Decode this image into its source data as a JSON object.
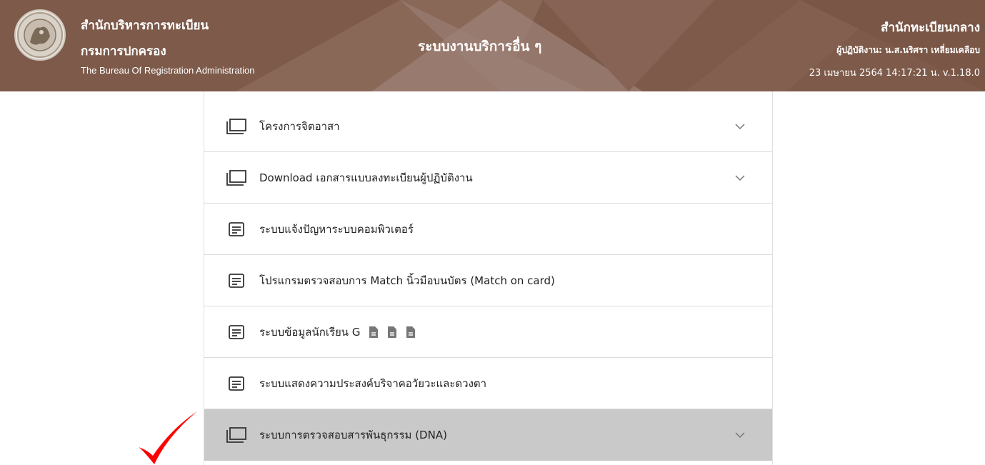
{
  "header": {
    "org_name_line1": "สำนักบริหารการทะเบียน",
    "org_name_line2": "กรมการปกครอง",
    "org_name_en": "The Bureau Of Registration Administration",
    "page_title": "ระบบงานบริการอื่น ๆ",
    "office_name": "สำนักทะเบียนกลาง",
    "operator": "ผู้ปฏิบัติงาน: น.ส.นริศรา เหลี่ยมเคลือบ",
    "datetime_version": "23 เมษายน 2564 14:17:21 น.  v.1.18.0",
    "colors": {
      "background": "#7d5a4a",
      "text": "#ffffff"
    }
  },
  "menu": {
    "items": [
      {
        "label": "โครงการจิตอาสา",
        "icon": "folder-icon",
        "expandable": true
      },
      {
        "label": "Download เอกสารแบบลงทะเบียนผู้ปฏิบัติงาน",
        "icon": "folder-icon",
        "expandable": true
      },
      {
        "label": "ระบบแจ้งปัญหาระบบคอมพิวเตอร์",
        "icon": "document-list-icon",
        "expandable": false
      },
      {
        "label": "โปรแกรมตรวจสอบการ Match นิ้วมือบนบัตร (Match on card)",
        "icon": "document-list-icon",
        "expandable": false
      },
      {
        "label": "ระบบข้อมูลนักเรียน G",
        "icon": "document-list-icon",
        "expandable": false,
        "extra_icons": [
          "file-icon",
          "file-icon",
          "file-icon"
        ]
      },
      {
        "label": "ระบบแสดงความประสงค์บริจาคอวัยวะและดวงตา",
        "icon": "document-list-icon",
        "expandable": false
      },
      {
        "label": "ระบบการตรวจสอบสารพันธุกรรม (DNA)",
        "icon": "folder-icon",
        "expandable": true,
        "highlighted": true
      }
    ],
    "colors": {
      "highlight": "#c9c9c9",
      "divider": "#dcdcdc"
    }
  },
  "annotation": {
    "icon": "checkmark-icon",
    "color": "#ff0000"
  }
}
